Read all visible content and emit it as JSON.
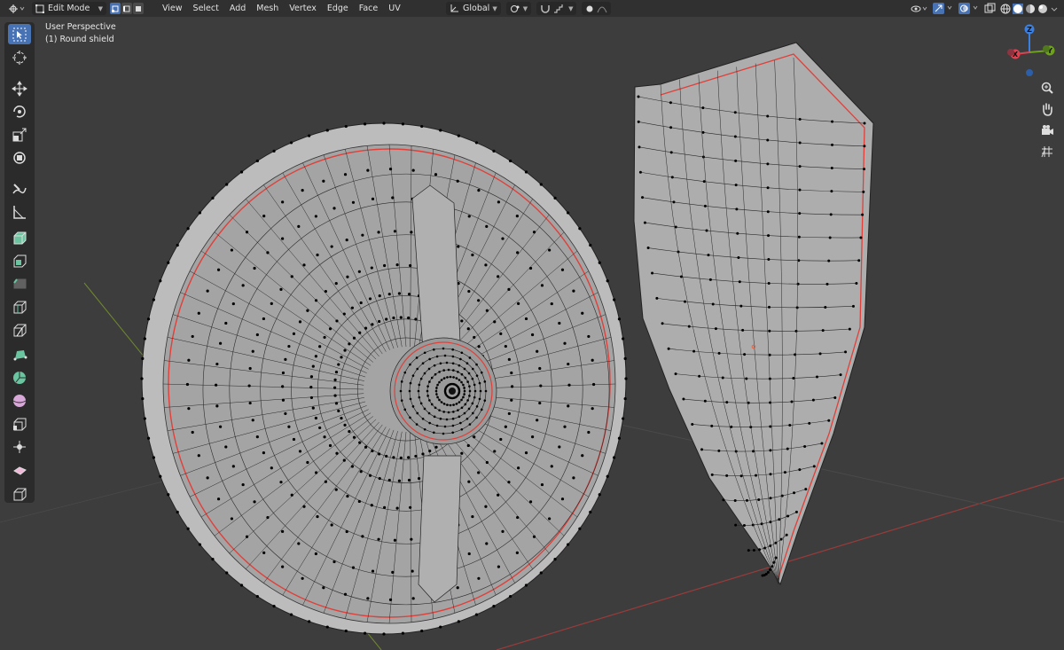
{
  "header": {
    "editor_type_icon": "3d-viewport-icon",
    "mode": "Edit Mode",
    "select_modes": [
      "vertex",
      "edge",
      "face"
    ],
    "active_select_mode": "vertex",
    "menus": [
      "View",
      "Select",
      "Add",
      "Mesh",
      "Vertex",
      "Edge",
      "Face",
      "UV"
    ],
    "transform_orientation": "Global"
  },
  "viewport": {
    "perspective_label": "User Perspective",
    "object_label": "(1) Round shield",
    "background_color": "#3d3d3d",
    "mesh_color": "#a9a9a9",
    "seam_color": "#e0403a",
    "x_axis_color": "#9a3b3b",
    "y_axis_color": "#6f8a2e"
  },
  "toolbar": {
    "tools": [
      "select-box",
      "cursor",
      "move",
      "rotate",
      "scale",
      "transform",
      "annotate",
      "measure",
      "extrude-region",
      "inset-faces",
      "bevel",
      "loop-cut",
      "knife",
      "poly-build",
      "spin",
      "smooth",
      "edge-slide",
      "shrink-fatten",
      "shear"
    ],
    "active_tool": "select-box"
  },
  "gizmo": {
    "axes": [
      "X",
      "Y",
      "Z"
    ],
    "x_color": "#e0404f",
    "y_color": "#6da11e",
    "z_color": "#3a80e0"
  },
  "nav_buttons": [
    "zoom",
    "pan",
    "camera",
    "ortho-grid"
  ]
}
